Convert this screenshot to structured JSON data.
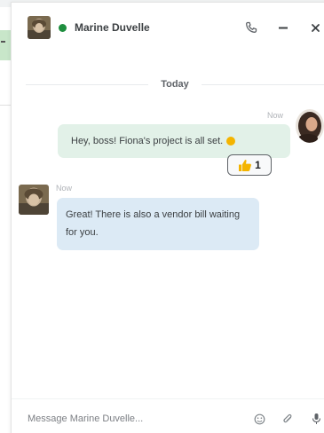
{
  "contact": {
    "name": "Marine Duvelle",
    "status": "online",
    "status_color": "#1e8e3e"
  },
  "header_actions": [
    {
      "icon": "phone-icon"
    },
    {
      "icon": "minimize-icon"
    },
    {
      "icon": "close-icon"
    }
  ],
  "day_separator": "Today",
  "messages": [
    {
      "direction": "outgoing",
      "time": "Now",
      "text": "Hey, boss! Fiona's project is all set.",
      "emoji": "smile-emoji",
      "reaction": {
        "icon": "thumbs-up-icon",
        "count": "1"
      }
    },
    {
      "direction": "incoming",
      "time": "Now",
      "text": "Great! There is also a vendor bill waiting for you."
    }
  ],
  "composer": {
    "placeholder": "Message Marine Duvelle...",
    "actions": [
      "emoji-icon",
      "attachment-icon",
      "microphone-icon"
    ]
  },
  "colors": {
    "outgoing_bubble": "#e2f1e8",
    "incoming_bubble": "#dceaf5",
    "reaction_border": "#5f6368"
  }
}
